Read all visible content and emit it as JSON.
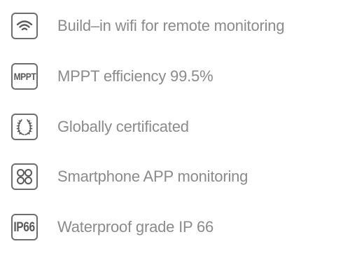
{
  "features": [
    {
      "icon": "wifi-icon",
      "label": "Build–in wifi for remote monitoring"
    },
    {
      "icon": "mppt-badge",
      "badge_text": "MPPT",
      "label": "MPPT efficiency 99.5%"
    },
    {
      "icon": "laurel-wreath-icon",
      "label": "Globally certificated"
    },
    {
      "icon": "app-grid-icon",
      "label": "Smartphone APP monitoring"
    },
    {
      "icon": "ip66-badge",
      "badge_text": "IP66",
      "label": "Waterproof grade IP 66"
    }
  ],
  "colors": {
    "icon_stroke": "#6e6e6e",
    "label_text": "#8b8b8b",
    "background": "#ffffff"
  }
}
